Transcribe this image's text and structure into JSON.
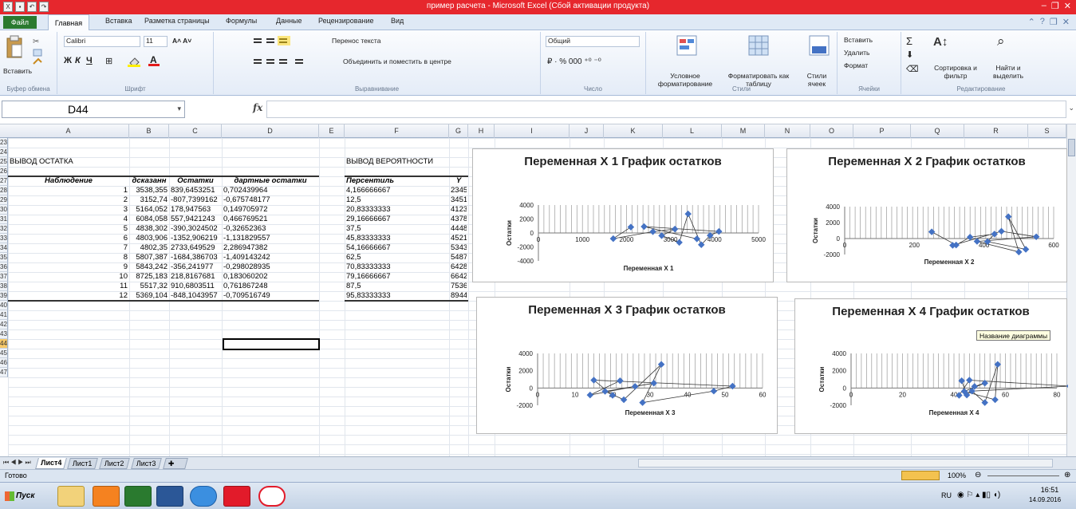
{
  "window": {
    "title": "пример расчета - Microsoft Excel (Сбой активации продукта)"
  },
  "ribbon": {
    "tabs": [
      "Файл",
      "Главная",
      "Вставка",
      "Разметка страницы",
      "Формулы",
      "Данные",
      "Рецензирование",
      "Вид"
    ],
    "paste_label": "Вставить",
    "clipboard_label": "Буфер обмена",
    "font_name": "Calibri",
    "font_size": "11",
    "font_group": "Шрифт",
    "bold": "Ж",
    "italic": "К",
    "underline": "Ч",
    "wrap_text": "Перенос текста",
    "merge_center": "Объединить и поместить в центре",
    "alignment_group": "Выравнивание",
    "number_format": "Общий",
    "number_group": "Число",
    "cond_format": "Условное форматирование",
    "format_table": "Форматировать как таблицу",
    "cell_styles": "Стили ячеек",
    "styles_group": "Стили",
    "insert_cells": "Вставить",
    "delete_cells": "Удалить",
    "format_cells": "Формат",
    "cells_group": "Ячейки",
    "sort_filter": "Сортировка и фильтр",
    "find_select": "Найти и выделить",
    "editing_group": "Редактирование"
  },
  "formula_bar": {
    "name_box": "D44",
    "fx": "fx",
    "content": ""
  },
  "columns": [
    "A",
    "B",
    "C",
    "D",
    "E",
    "F",
    "G",
    "H",
    "I",
    "J",
    "K",
    "L",
    "M",
    "N",
    "O",
    "P",
    "Q",
    "R",
    "S"
  ],
  "rows": [
    "23",
    "24",
    "25",
    "26",
    "27",
    "28",
    "29",
    "30",
    "31",
    "32",
    "33",
    "34",
    "35",
    "36",
    "37",
    "38",
    "39",
    "40",
    "41",
    "42",
    "43",
    "44",
    "45",
    "46",
    "47"
  ],
  "sheet": {
    "residual_title": "ВЫВОД ОСТАТКА",
    "prob_title": "ВЫВОД ВЕРОЯТНОСТИ",
    "residual_headers": [
      "Наблюдение",
      "дсказанн",
      "Остатки",
      "дартные остатки"
    ],
    "prob_headers": [
      "Персентиль",
      "Y"
    ],
    "residual_rows": [
      [
        "1",
        "3538,355",
        "839,6453251",
        "0,702439964"
      ],
      [
        "2",
        "3152,74",
        "-807,7399162",
        "-0,675748177"
      ],
      [
        "3",
        "5164,052",
        "178,947563",
        "0,149705972"
      ],
      [
        "4",
        "6084,058",
        "557,9421243",
        "0,466769521"
      ],
      [
        "5",
        "4838,302",
        "-390,3024502",
        "-0,32652363"
      ],
      [
        "6",
        "4803,906",
        "-1352,906219",
        "-1,131829557"
      ],
      [
        "7",
        "4802,35",
        "2733,649529",
        "2,286947382"
      ],
      [
        "8",
        "5807,387",
        "-1684,386703",
        "-1,409143242"
      ],
      [
        "9",
        "5843,242",
        "-356,241977",
        "-0,298028935"
      ],
      [
        "10",
        "8725,183",
        "218,8167681",
        "0,183060202"
      ],
      [
        "11",
        "5517,32",
        "910,6803511",
        "0,761867248"
      ],
      [
        "12",
        "5369,104",
        "-848,1043957",
        "-0,709516749"
      ]
    ],
    "prob_rows": [
      [
        "4,166666667",
        "2345"
      ],
      [
        "12,5",
        "3451"
      ],
      [
        "20,83333333",
        "4123"
      ],
      [
        "29,16666667",
        "4378"
      ],
      [
        "37,5",
        "4448"
      ],
      [
        "45,83333333",
        "4521"
      ],
      [
        "54,16666667",
        "5343"
      ],
      [
        "62,5",
        "5487"
      ],
      [
        "70,83333333",
        "6428"
      ],
      [
        "79,16666667",
        "6642"
      ],
      [
        "87,5",
        "7536"
      ],
      [
        "95,83333333",
        "8944"
      ]
    ]
  },
  "chart_data": [
    {
      "type": "scatter",
      "title": "Переменная X 1 График остатков",
      "xlabel": "Переменная X 1",
      "ylabel": "Остатки",
      "xlim": [
        0,
        5000
      ],
      "ylim": [
        -4000,
        4000
      ],
      "xticks": [
        "0",
        "1000",
        "2000",
        "3000",
        "4000",
        "5000"
      ],
      "yticks": [
        "4000",
        "2000",
        "0",
        "-2000",
        "-4000"
      ],
      "x": [
        2100,
        1700,
        2600,
        3100,
        2800,
        3200,
        3400,
        3700,
        3900,
        4100,
        2400,
        3600
      ],
      "y": [
        840,
        -808,
        179,
        558,
        -390,
        -1353,
        2734,
        -1684,
        -356,
        219,
        911,
        -848
      ]
    },
    {
      "type": "scatter",
      "title": "Переменная X 2 График остатков",
      "xlabel": "Переменная X 2",
      "ylabel": "Остатки",
      "xlim": [
        0,
        600
      ],
      "ylim": [
        -2000,
        4000
      ],
      "xticks": [
        "0",
        "200",
        "400",
        "600"
      ],
      "yticks": [
        "4000",
        "2000",
        "0",
        "-2000"
      ],
      "x": [
        250,
        320,
        360,
        430,
        410,
        520,
        470,
        500,
        380,
        550,
        450,
        310
      ],
      "y": [
        840,
        -808,
        179,
        558,
        -390,
        -1353,
        2734,
        -1684,
        -356,
        219,
        911,
        -848
      ]
    },
    {
      "type": "scatter",
      "title": "Переменная X 3 График остатков",
      "xlabel": "Переменная X 3",
      "ylabel": "Остатки",
      "xlim": [
        0,
        60
      ],
      "ylim": [
        -2000,
        4000
      ],
      "xticks": [
        "0",
        "10",
        "20",
        "30",
        "40",
        "50",
        "60"
      ],
      "yticks": [
        "4000",
        "2000",
        "0",
        "-2000"
      ],
      "x": [
        22,
        14,
        26,
        31,
        18,
        23,
        33,
        28,
        47,
        52,
        15,
        20
      ],
      "y": [
        840,
        -808,
        179,
        558,
        -390,
        -1353,
        2734,
        -1684,
        -356,
        219,
        911,
        -848
      ]
    },
    {
      "type": "scatter",
      "title": "Переменная X 4 График остатков",
      "xlabel": "Переменная X 4",
      "ylabel": "Остатки",
      "xlim": [
        0,
        80
      ],
      "ylim": [
        -2000,
        4000
      ],
      "xticks": [
        "0",
        "20",
        "40",
        "60",
        "80"
      ],
      "yticks": [
        "4000",
        "2000",
        "0",
        "-2000"
      ],
      "x": [
        43,
        45,
        48,
        52,
        44,
        56,
        57,
        52,
        47,
        85,
        46,
        42
      ],
      "y": [
        840,
        -808,
        179,
        558,
        -390,
        -1353,
        2734,
        -1684,
        -356,
        219,
        911,
        -848
      ]
    }
  ],
  "tooltip": "Название диаграммы",
  "sheet_tabs": [
    "Лист4",
    "Лист1",
    "Лист2",
    "Лист3"
  ],
  "status": {
    "ready": "Готово",
    "zoom": "100%"
  },
  "taskbar": {
    "start": "Пуск",
    "lang": "RU",
    "time": "16:51",
    "date": "14.09.2016"
  },
  "colors": {
    "title_bar": "#e6272d",
    "file_tab": "#2a7a2f",
    "series": "#4472c4",
    "selection": "#000000"
  }
}
